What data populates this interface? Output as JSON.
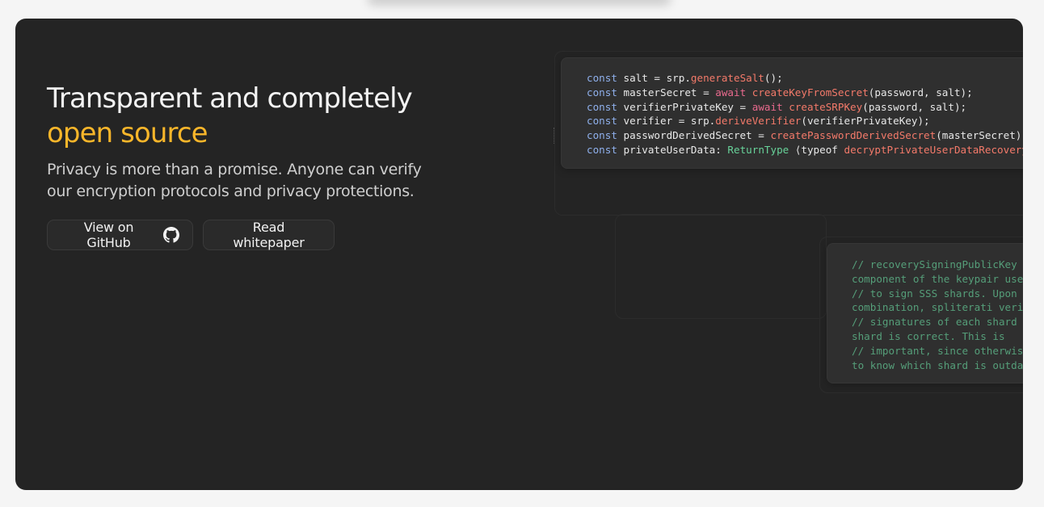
{
  "hero": {
    "title_line1": "Transparent and completely",
    "title_line2": "open source",
    "subtitle": "Privacy is more than a promise. Anyone can verify our encryption protocols and privacy protections.",
    "accent_color": "#f9b62a",
    "background_color": "#242424"
  },
  "buttons": {
    "github_label": "View on GitHub",
    "github_icon": "github-icon",
    "whitepaper_label": "Read whitepaper"
  },
  "code_primary": {
    "lines": [
      [
        {
          "t": "const ",
          "c": "kw"
        },
        {
          "t": "salt = srp.",
          "c": "plain"
        },
        {
          "t": "generateSalt",
          "c": "fn"
        },
        {
          "t": "();",
          "c": "plain"
        }
      ],
      [
        {
          "t": "const ",
          "c": "kw"
        },
        {
          "t": "masterSecret = ",
          "c": "plain"
        },
        {
          "t": "await ",
          "c": "aw"
        },
        {
          "t": "createKeyFromSecret",
          "c": "fn"
        },
        {
          "t": "(password, salt);",
          "c": "plain"
        }
      ],
      [
        {
          "t": "const ",
          "c": "kw"
        },
        {
          "t": "verifierPrivateKey = ",
          "c": "plain"
        },
        {
          "t": "await ",
          "c": "aw"
        },
        {
          "t": "createSRPKey",
          "c": "fn"
        },
        {
          "t": "(password, salt);",
          "c": "plain"
        }
      ],
      [
        {
          "t": "const ",
          "c": "kw"
        },
        {
          "t": "verifier = srp.",
          "c": "plain"
        },
        {
          "t": "deriveVerifier",
          "c": "fn"
        },
        {
          "t": "(verifierPrivateKey);",
          "c": "plain"
        }
      ],
      [
        {
          "t": "const ",
          "c": "kw"
        },
        {
          "t": "passwordDerivedSecret = ",
          "c": "plain"
        },
        {
          "t": "createPasswordDerivedSecret",
          "c": "fn"
        },
        {
          "t": "(masterSecret);",
          "c": "plain"
        }
      ],
      [
        {
          "t": "const ",
          "c": "kw"
        },
        {
          "t": "privateUserData: ",
          "c": "plain"
        },
        {
          "t": "ReturnType ",
          "c": "typ"
        },
        {
          "t": "⟨typeof ",
          "c": "plain"
        },
        {
          "t": "decryptPrivateUserDataRecovery",
          "c": "fn"
        },
        {
          "t": "⟩",
          "c": "plain"
        }
      ]
    ]
  },
  "code_secondary": {
    "lines": [
      "// recoverySigningPublicKey is",
      "component of the keypair used",
      "// to sign SSS shards. Upon sh",
      "combination, spliterati verifie",
      "// signatures of each shard to",
      "shard is correct. This is",
      "// important, since otherwise i",
      "to know which shard is outdate"
    ]
  }
}
